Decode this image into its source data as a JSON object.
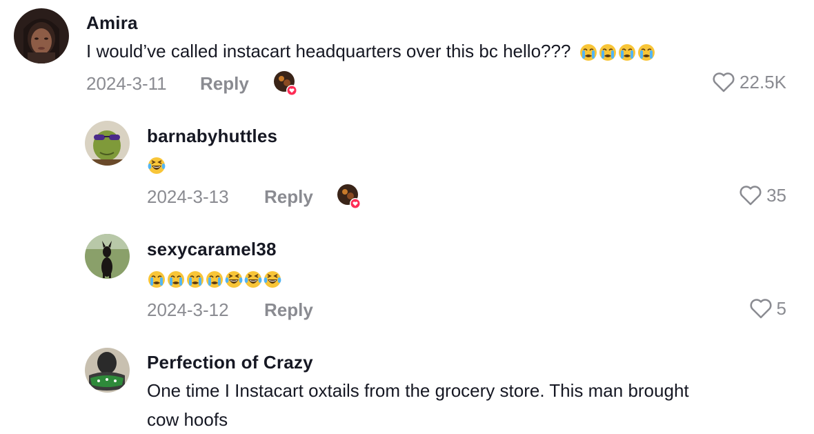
{
  "comments": [
    {
      "username": "Amira",
      "text": "I would’ve called instacart headquarters over this bc hello???",
      "emojis": [
        "crying",
        "crying",
        "crying",
        "crying"
      ],
      "date": "2024-3-11",
      "reply_label": "Reply",
      "likes": "22.5K"
    },
    {
      "username": "barnabyhuttles",
      "text": "",
      "emojis": [
        "laughing"
      ],
      "date": "2024-3-13",
      "reply_label": "Reply",
      "likes": "35"
    },
    {
      "username": "sexycaramel38",
      "text": "",
      "emojis": [
        "crying",
        "crying",
        "crying",
        "crying",
        "laughing",
        "laughing",
        "laughing"
      ],
      "date": "2024-3-12",
      "reply_label": "Reply",
      "likes": "5"
    },
    {
      "username": "Perfection of Crazy",
      "text_line1": "One time I Instacart oxtails from the grocery store. This man brought",
      "text_line2": "cow hoofs"
    }
  ],
  "icons": {
    "like": "heart-outline-icon",
    "creator_liked": "creator-liked-badge"
  },
  "colors": {
    "text": "#161823",
    "muted": "#8a8b91",
    "badge": "#fe2c55"
  }
}
